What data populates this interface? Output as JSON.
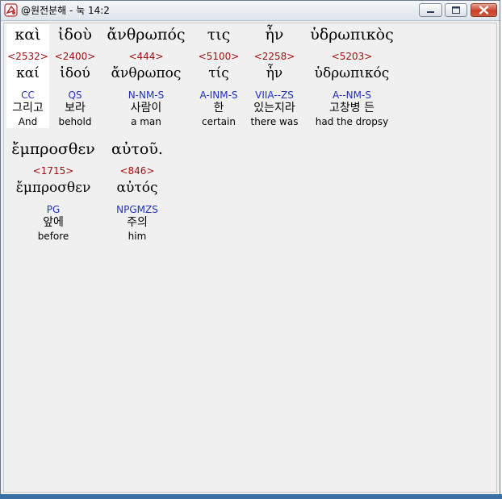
{
  "window": {
    "title": "@원전분해 - 눅 14:2"
  },
  "row1": [
    {
      "surface": "καὶ",
      "strong": "<2532>",
      "lemma": "καί",
      "morph": "CC",
      "korean": "그리고",
      "english": "And"
    },
    {
      "surface": "ἰδοὺ",
      "strong": "<2400>",
      "lemma": "ἰδού",
      "morph": "QS",
      "korean": "보라",
      "english": "behold"
    },
    {
      "surface": "ἄνθρωπός",
      "strong": "<444>",
      "lemma": "ἄνθρωπος",
      "morph": "N-NM-S",
      "korean": "사람이",
      "english": "a man"
    },
    {
      "surface": "τις",
      "strong": "<5100>",
      "lemma": "τίς",
      "morph": "A-INM-S",
      "korean": "한",
      "english": "certain"
    },
    {
      "surface": "ἦν",
      "strong": "<2258>",
      "lemma": "ἦν",
      "morph": "VIIA--ZS",
      "korean": "있는지라",
      "english": "there was"
    },
    {
      "surface": "ὑδρωπικὸς",
      "strong": "<5203>",
      "lemma": "ὑδρωπικός",
      "morph": "A--NM-S",
      "korean": "고창병 든",
      "english": "had the dropsy"
    }
  ],
  "row2": [
    {
      "surface": "ἔμπροσθεν",
      "strong": "<1715>",
      "lemma": "ἔμπροσθεν",
      "morph": "PG",
      "korean": "앞에",
      "english": "before"
    },
    {
      "surface": "αὐτοῦ.",
      "strong": "<846>",
      "lemma": "αὐτός",
      "morph": "NPGMZS",
      "korean": "주의",
      "english": "him"
    }
  ]
}
